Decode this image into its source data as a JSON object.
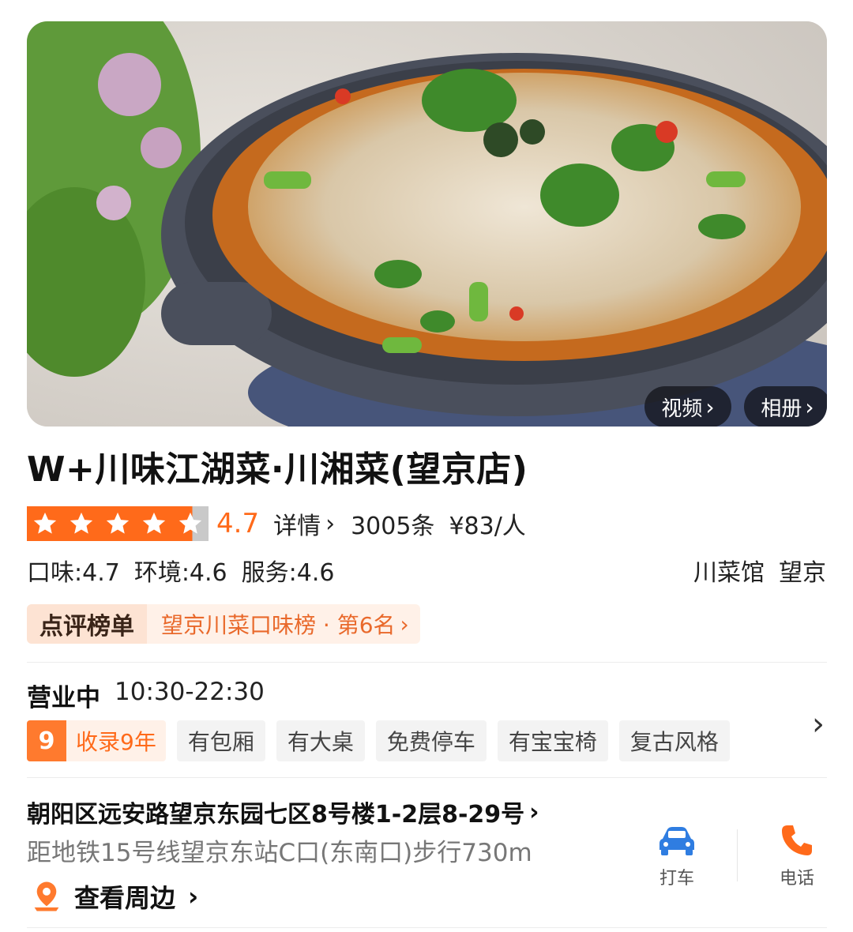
{
  "hero": {
    "video_label": "视频",
    "album_label": "相册"
  },
  "shop": {
    "name": "W+川味江湖菜·川湘菜(望京店)",
    "rating": {
      "stars": 4.7,
      "score": "4.7",
      "detail_label": "详情",
      "review_count": "3005条",
      "price": "¥83/人"
    },
    "sub_scores": [
      "口味:4.7",
      "环境:4.6",
      "服务:4.6"
    ],
    "category": "川菜馆",
    "area": "望京",
    "ranking": {
      "label": "点评榜单",
      "text": "望京川菜口味榜 · 第6名"
    },
    "hours": {
      "status": "营业中",
      "time": "10:30-22:30"
    },
    "listed": {
      "years": "9",
      "label": "收录9年"
    },
    "tags": [
      "有包厢",
      "有大桌",
      "免费停车",
      "有宝宝椅",
      "复古风格"
    ],
    "address": "朝阳区远安路望京东园七区8号楼1-2层8-29号",
    "metro": "距地铁15号线望京东站C口(东南口)步行730m",
    "nearby_label": "查看周边",
    "actions": {
      "taxi": "打车",
      "phone": "电话"
    }
  },
  "colors": {
    "accent": "#ff6a1a",
    "taxi_icon": "#2f7de1",
    "phone_icon": "#ff6a1a"
  }
}
